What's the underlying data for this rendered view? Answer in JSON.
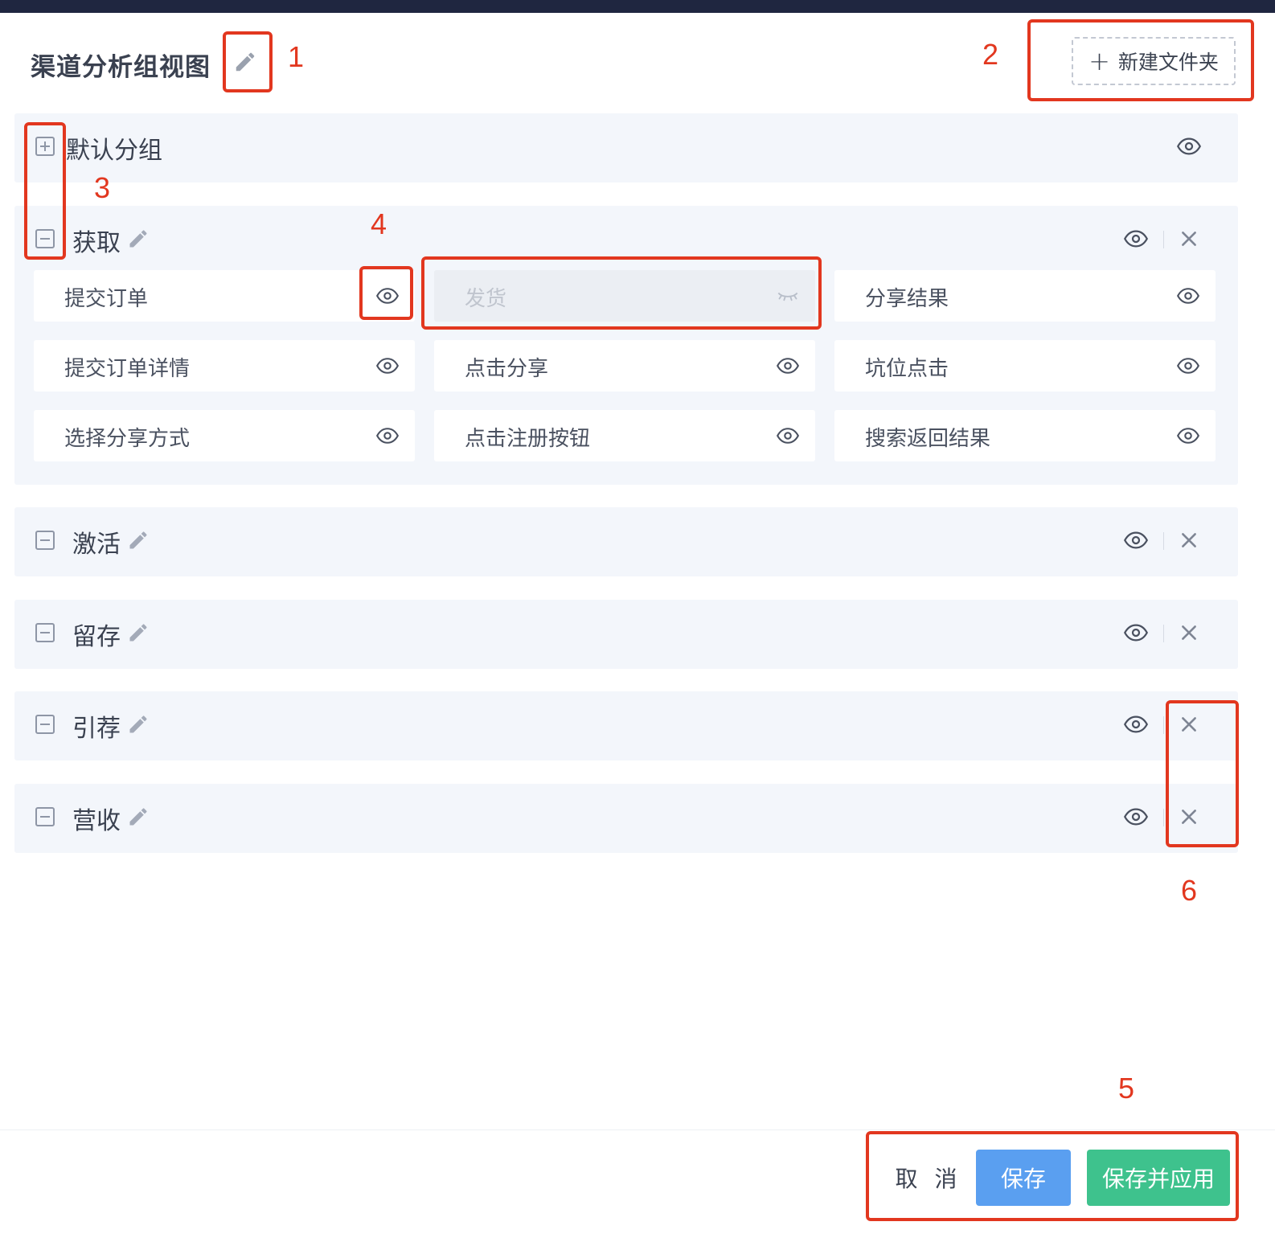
{
  "header": {
    "title": "渠道分析组视图",
    "new_folder_label": "新建文件夹",
    "new_folder_icon": "+"
  },
  "groups": [
    {
      "name": "默认分组",
      "expanded": false
    },
    {
      "name": "获取",
      "expanded": true,
      "items": [
        {
          "label": "提交订单",
          "visible": true
        },
        {
          "label": "发货",
          "visible": false
        },
        {
          "label": "分享结果",
          "visible": true
        },
        {
          "label": "提交订单详情",
          "visible": true
        },
        {
          "label": "点击分享",
          "visible": true
        },
        {
          "label": "坑位点击",
          "visible": true
        },
        {
          "label": "选择分享方式",
          "visible": true
        },
        {
          "label": "点击注册按钮",
          "visible": true
        },
        {
          "label": "搜索返回结果",
          "visible": true
        }
      ]
    },
    {
      "name": "激活",
      "expanded": false
    },
    {
      "name": "留存",
      "expanded": false
    },
    {
      "name": "引荐",
      "expanded": false
    },
    {
      "name": "营收",
      "expanded": false
    }
  ],
  "footer": {
    "cancel_label": "取 消",
    "save_label": "保存",
    "save_apply_label": "保存并应用"
  },
  "annotations": [
    "1",
    "2",
    "3",
    "4",
    "5",
    "6"
  ],
  "colors": {
    "annotation": "#e2371f",
    "save_button": "#5a9ff0",
    "save_apply_button": "#3ec28d",
    "group_background": "#f3f6fb",
    "top_bar": "#1f2640"
  }
}
